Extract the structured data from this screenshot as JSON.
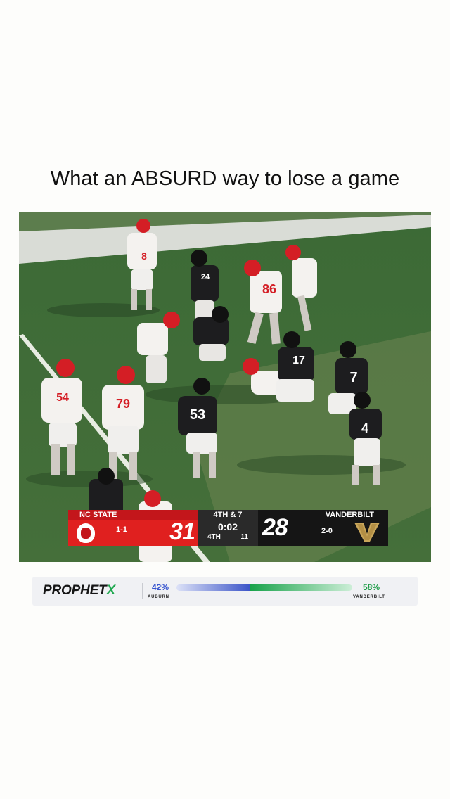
{
  "post": {
    "title": "What an ABSURD way to lose a game"
  },
  "scorebug": {
    "home_team": "NC STATE",
    "home_record": "1-1",
    "home_score": "31",
    "down_distance": "4TH & 7",
    "clock": "0:02",
    "quarter": "4TH",
    "play_clock": "11",
    "away_team": "VANDERBILT",
    "away_record": "2-0",
    "away_score": "28",
    "home_color": "#e0201f",
    "away_color": "#151515"
  },
  "jersey_numbers": [
    "8",
    "24",
    "86",
    "54",
    "79",
    "53",
    "17",
    "7",
    "4"
  ],
  "odds_bar": {
    "brand": "PROPHET",
    "brand_x": "X",
    "left_percent": "42%",
    "left_team": "AUBURN",
    "left_value": 42,
    "left_color": "#3b54c8",
    "right_percent": "58%",
    "right_team": "VANDERBILT",
    "right_value": 58,
    "right_color": "#17a24a"
  }
}
